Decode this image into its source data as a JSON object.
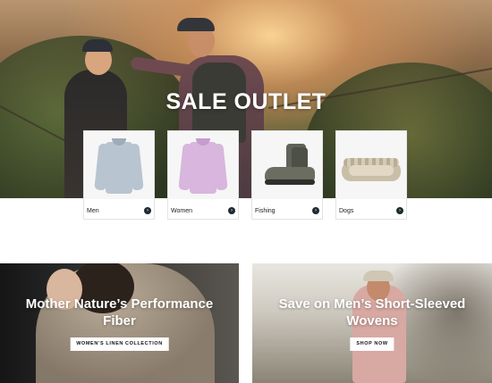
{
  "hero": {
    "title": "SALE OUTLET",
    "categories": [
      {
        "label": "Men",
        "icon": "arrow-right-icon"
      },
      {
        "label": "Women",
        "icon": "arrow-right-icon"
      },
      {
        "label": "Fishing",
        "icon": "arrow-right-icon"
      },
      {
        "label": "Dogs",
        "icon": "arrow-right-icon"
      }
    ]
  },
  "promos": [
    {
      "title_line1": "Mother Nature’s Performance",
      "title_line2": "Fiber",
      "button": "WOMEN’S LINEN COLLECTION"
    },
    {
      "title_line1": "Save on Men’s Short-Sleeved",
      "title_line2": "Wovens",
      "button": "SHOP NOW"
    }
  ],
  "colors": {
    "arrow": "#1e2a2e",
    "button_bg": "#ffffff",
    "text_light": "#ffffff"
  }
}
